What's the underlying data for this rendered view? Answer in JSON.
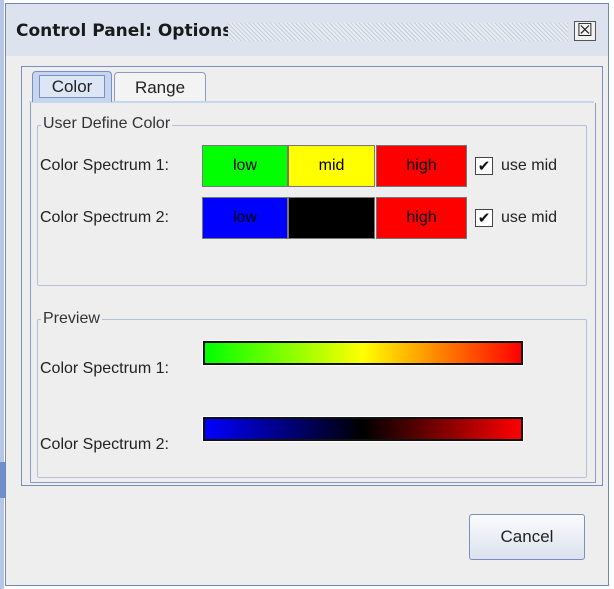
{
  "window": {
    "title": "Control Panel: Options",
    "close_symbol": "☒"
  },
  "tabs": [
    {
      "label": "Color",
      "active": true
    },
    {
      "label": "Range",
      "active": false
    }
  ],
  "user_define_color": {
    "legend": "User Define Color",
    "rows": [
      {
        "label": "Color Spectrum 1:",
        "low": {
          "text": "low",
          "bg": "#00ff00"
        },
        "mid": {
          "text": "mid",
          "bg": "#ffff00"
        },
        "high": {
          "text": "high",
          "bg": "#ff0000"
        },
        "use_mid_label": "use mid",
        "use_mid_checked": true
      },
      {
        "label": "Color Spectrum 2:",
        "low": {
          "text": "low",
          "bg": "#0000ff"
        },
        "mid": {
          "text": "",
          "bg": "#000000"
        },
        "high": {
          "text": "high",
          "bg": "#ff0000"
        },
        "use_mid_label": "use mid",
        "use_mid_checked": true
      }
    ]
  },
  "preview": {
    "legend": "Preview",
    "rows": [
      {
        "label": "Color Spectrum 1:",
        "gradient": [
          "#00ff00",
          "#ffff00",
          "#ff0000"
        ]
      },
      {
        "label": "Color Spectrum 2:",
        "gradient": [
          "#0000ff",
          "#000000",
          "#ff0000"
        ]
      }
    ]
  },
  "buttons": {
    "cancel": "Cancel"
  },
  "check_symbol": "✔"
}
